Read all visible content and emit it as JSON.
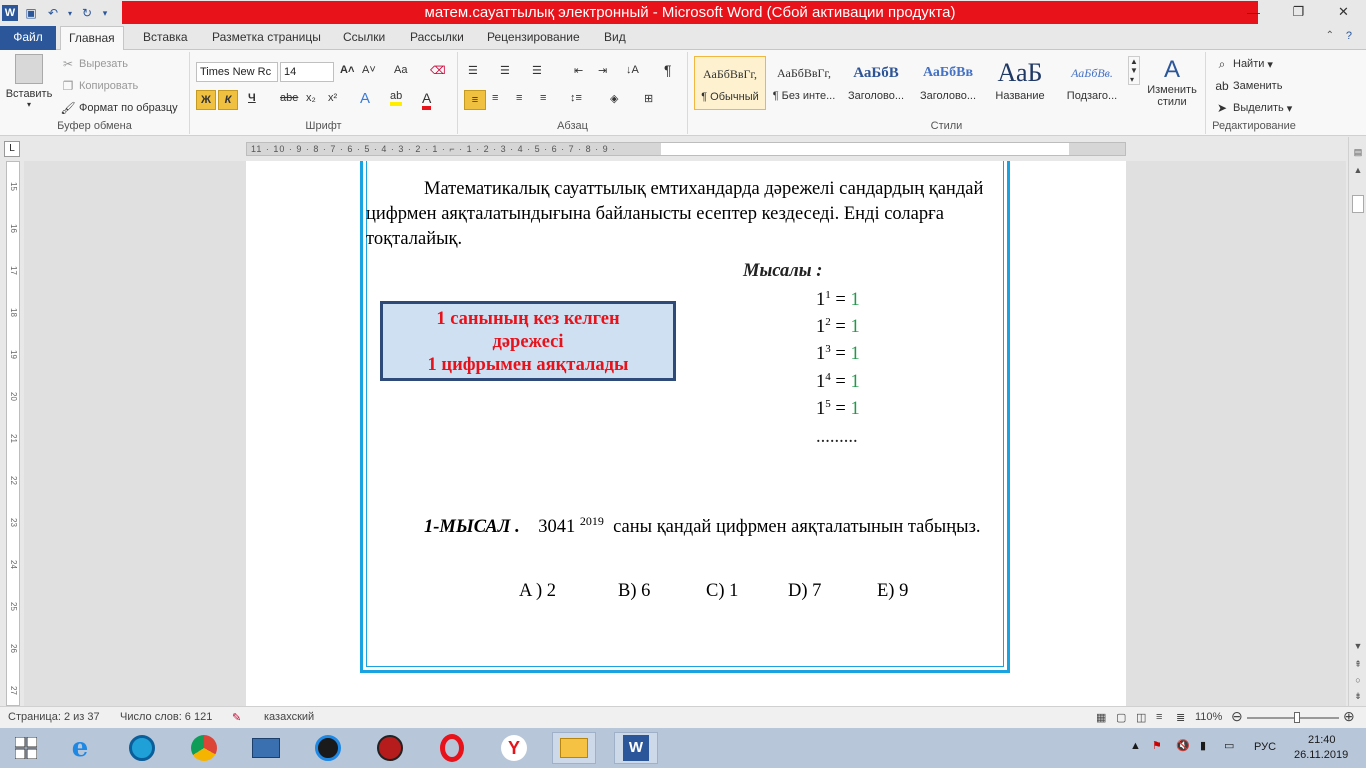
{
  "window": {
    "title": "матем.сауаттылық электронный  -  Microsoft Word (Сбой активации продукта)",
    "quick_access": [
      "save-icon",
      "undo-icon",
      "redo-icon"
    ],
    "controls": [
      "minimize",
      "restore",
      "close"
    ]
  },
  "tabs": [
    {
      "label": "Файл"
    },
    {
      "label": "Главная"
    },
    {
      "label": "Вставка"
    },
    {
      "label": "Разметка страницы"
    },
    {
      "label": "Ссылки"
    },
    {
      "label": "Рассылки"
    },
    {
      "label": "Рецензирование"
    },
    {
      "label": "Вид"
    }
  ],
  "ribbon": {
    "clipboard": {
      "paste": "Вставить",
      "cut": "Вырезать",
      "copy": "Копировать",
      "format_painter": "Формат по образцу",
      "label": "Буфер обмена"
    },
    "font": {
      "family": "Times New Rc",
      "size": "14",
      "label": "Шрифт",
      "bold": "Ж",
      "italic": "К",
      "underline": "Ч",
      "strike": "abe",
      "subscript": "x₂",
      "superscript": "x²",
      "grow": "A˄",
      "shrink": "A˅",
      "case": "Aa"
    },
    "paragraph": {
      "label": "Абзац",
      "pilcrow": "¶"
    },
    "styles": {
      "label": "Стили",
      "items": [
        {
          "preview": "АаБбВвГг,",
          "name": "¶ Обычный"
        },
        {
          "preview": "АаБбВвГг,",
          "name": "¶ Без инте..."
        },
        {
          "preview": "АаБбВ",
          "name": "Заголово..."
        },
        {
          "preview": "АаБбВв",
          "name": "Заголово..."
        },
        {
          "preview": "АаБ",
          "name": "Название"
        },
        {
          "preview": "АаБбВв.",
          "name": "Подзаго..."
        }
      ],
      "change": "Изменить стили"
    },
    "editing": {
      "label": "Редактирование",
      "find": "Найти",
      "replace": "Заменить",
      "select": "Выделить"
    }
  },
  "document": {
    "intro": "Математикалық сауаттылық емтихандарда дәрежелі сандардың қандай цифрмен аяқталатындығына байланысты есептер кездеседі. Енді соларға тоқталайық.",
    "example_title": "Мысалы :",
    "equations": [
      {
        "base": "1",
        "exp": "1",
        "result": "1"
      },
      {
        "base": "1",
        "exp": "2",
        "result": "1"
      },
      {
        "base": "1",
        "exp": "3",
        "result": "1"
      },
      {
        "base": "1",
        "exp": "4",
        "result": "1"
      },
      {
        "base": "1",
        "exp": "5",
        "result": "1"
      }
    ],
    "dots": ".........",
    "rule_lines": [
      "1 санының кез келген",
      "дәрежесі",
      "1 цифрымен аяқталады"
    ],
    "problem_lead": "1-МЫСАЛ .",
    "problem_number": "3041",
    "problem_exp": "2019",
    "problem_text": "саны қандай цифрмен аяқталатынын табыңыз.",
    "answers": [
      "A ) 2",
      "B) 6",
      "C) 1",
      "D) 7",
      "E) 9"
    ]
  },
  "ruler": {
    "horizontal": "11 · 10 · 9 · 8 · 7 · 6 · 5 · 4 · 3 · 2 · 1 · ⌐ · 1 · 2 · 3 · 4 · 5 · 6 · 7 · 8 · 9 ·",
    "vertical": [
      "15",
      "16",
      "17",
      "18",
      "19",
      "20",
      "21",
      "22",
      "23",
      "24",
      "25",
      "26",
      "27"
    ]
  },
  "status": {
    "page": "Страница: 2 из 37",
    "words": "Число слов: 6 121",
    "language": "казахский",
    "zoom": "110%"
  },
  "taskbar": {
    "apps": [
      "start",
      "internet-explorer",
      "app-blue",
      "chrome",
      "keyboard-app",
      "ccleaner",
      "game-app",
      "opera",
      "yandex",
      "file-explorer",
      "word"
    ],
    "lang": "РУС",
    "time": "21:40",
    "date": "26.11.2019"
  }
}
